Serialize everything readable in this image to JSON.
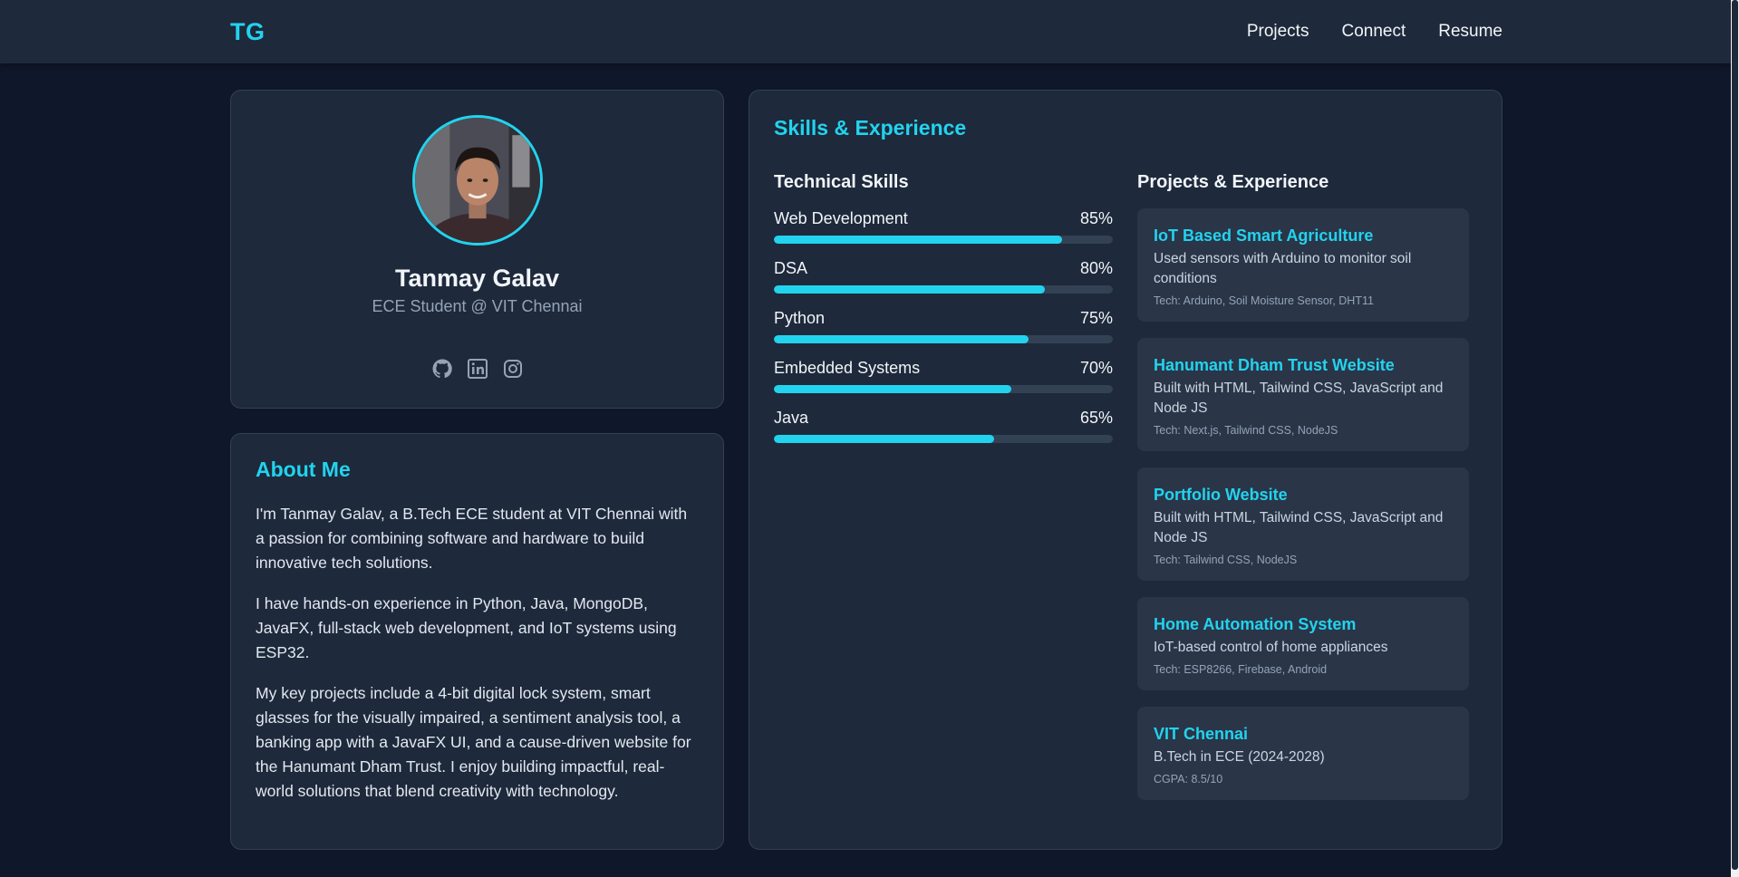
{
  "nav": {
    "logo": "TG",
    "links": [
      "Projects",
      "Connect",
      "Resume"
    ]
  },
  "profile": {
    "name": "Tanmay Galav",
    "title": "ECE Student @ VIT Chennai",
    "socials": [
      "github-icon",
      "linkedin-icon",
      "instagram-icon"
    ]
  },
  "about": {
    "heading": "About Me",
    "paragraphs": [
      "I'm Tanmay Galav, a B.Tech ECE student at VIT Chennai with a passion for combining software and hardware to build innovative tech solutions.",
      "I have hands-on experience in Python, Java, MongoDB, JavaFX, full-stack web development, and IoT systems using ESP32.",
      "My key projects include a 4-bit digital lock system, smart glasses for the visually impaired, a sentiment analysis tool, a banking app with a JavaFX UI, and a cause-driven website for the Hanumant Dham Trust. I enjoy building impactful, real-world solutions that blend creativity with technology."
    ]
  },
  "skills": {
    "heading": "Skills & Experience",
    "technical_heading": "Technical Skills",
    "items": [
      {
        "name": "Web Development",
        "percent_label": "85%",
        "fill": 0.85
      },
      {
        "name": "DSA",
        "percent_label": "80%",
        "fill": 0.8
      },
      {
        "name": "Python",
        "percent_label": "75%",
        "fill": 0.75
      },
      {
        "name": "Embedded Systems",
        "percent_label": "70%",
        "fill": 0.7
      },
      {
        "name": "Java",
        "percent_label": "65%",
        "fill": 0.65
      }
    ]
  },
  "projects": {
    "heading": "Projects & Experience",
    "items": [
      {
        "title": "IoT Based Smart Agriculture",
        "desc": "Used sensors with Arduino to monitor soil conditions",
        "tech": "Tech: Arduino, Soil Moisture Sensor, DHT11"
      },
      {
        "title": "Hanumant Dham Trust Website",
        "desc": "Built with HTML, Tailwind CSS, JavaScript and Node JS",
        "tech": "Tech: Next.js, Tailwind CSS, NodeJS"
      },
      {
        "title": "Portfolio Website",
        "desc": "Built with HTML, Tailwind CSS, JavaScript and Node JS",
        "tech": "Tech: Tailwind CSS, NodeJS"
      },
      {
        "title": "Home Automation System",
        "desc": "IoT-based control of home appliances",
        "tech": "Tech: ESP8266, Firebase, Android"
      },
      {
        "title": "VIT Chennai",
        "desc": "B.Tech in ECE (2024-2028)",
        "tech": "CGPA: 8.5/10"
      }
    ]
  },
  "colors": {
    "accent": "#22d3ee",
    "background": "#0f172a",
    "card": "#1e293b",
    "project_card": "#2a3548"
  }
}
